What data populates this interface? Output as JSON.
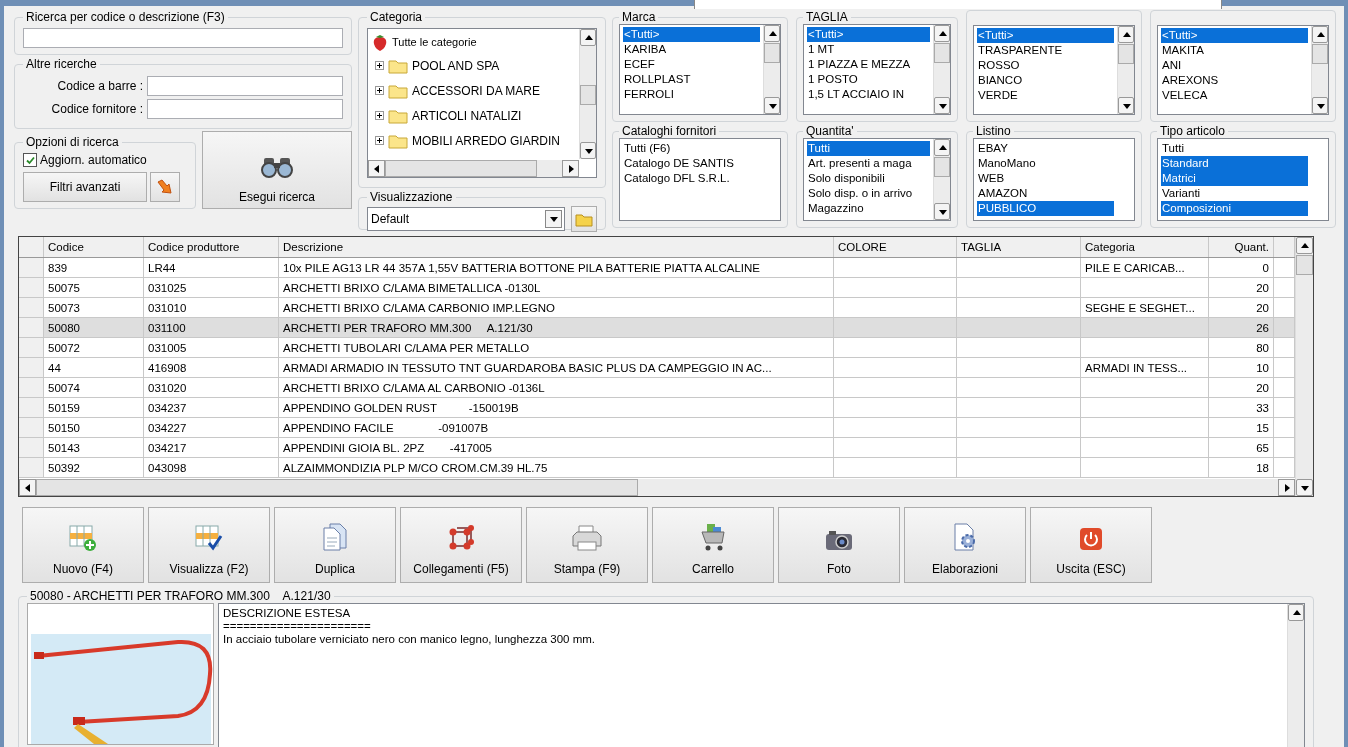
{
  "search": {
    "label": "Ricerca per codice o descrizione (F3)"
  },
  "other_searches": {
    "label": "Altre ricerche",
    "fields": [
      {
        "label": "Codice a barre :"
      },
      {
        "label": "Codice fornitore :"
      }
    ]
  },
  "search_options": {
    "label": "Opzioni di ricerca",
    "auto_update": {
      "label": "Aggiorn. automatico",
      "checked": true
    },
    "advanced_filters": "Filtri avanzati"
  },
  "run_search": "Esegui ricerca",
  "category": {
    "label": "Categoria",
    "root": "Tutte le categorie",
    "items": [
      {
        "label": "POOL AND SPA",
        "expanded": false
      },
      {
        "label": "ACCESSORI DA MARE",
        "expanded": false
      },
      {
        "label": "ARTICOLI NATALIZI",
        "expanded": false
      },
      {
        "label": "MOBILI ARREDO GIARDIN",
        "expanded": false
      }
    ]
  },
  "view": {
    "label": "Visualizzazione",
    "value": "Default"
  },
  "filters": [
    {
      "label": "Marca",
      "scroll": true,
      "items": [
        {
          "label": "<Tutti>",
          "selected": true
        },
        {
          "label": "KARIBA",
          "selected": false
        },
        {
          "label": "ECEF",
          "selected": false
        },
        {
          "label": "ROLLPLAST",
          "selected": false
        },
        {
          "label": "FERROLI",
          "selected": false
        }
      ]
    },
    {
      "label": "TAGLIA",
      "scroll": true,
      "items": [
        {
          "label": "<Tutti>",
          "selected": true
        },
        {
          "label": "1 MT",
          "selected": false
        },
        {
          "label": "1 PIAZZA E MEZZA",
          "selected": false
        },
        {
          "label": "1 POSTO",
          "selected": false
        },
        {
          "label": "1,5 LT ACCIAIO IN",
          "selected": false
        }
      ]
    },
    {
      "scroll": true,
      "items": [
        {
          "label": "<Tutti>",
          "selected": true
        },
        {
          "label": "TRASPARENTE",
          "selected": false
        },
        {
          "label": "ROSSO",
          "selected": false
        },
        {
          "label": "BIANCO",
          "selected": false
        },
        {
          "label": "VERDE",
          "selected": false
        }
      ]
    },
    {
      "scroll": true,
      "items": [
        {
          "label": "<Tutti>",
          "selected": true
        },
        {
          "label": "MAKITA",
          "selected": false
        },
        {
          "label": "ANI",
          "selected": false
        },
        {
          "label": "AREXONS",
          "selected": false
        },
        {
          "label": "VELECA",
          "selected": false
        }
      ]
    },
    {
      "label": "Cataloghi fornitori",
      "scroll": false,
      "items": [
        {
          "label": "Tutti (F6)",
          "selected": false
        },
        {
          "label": "Catalogo DE SANTIS",
          "selected": false
        },
        {
          "label": "Catalogo DFL S.R.L.",
          "selected": false
        }
      ]
    },
    {
      "label": "Quantita'",
      "scroll": true,
      "items": [
        {
          "label": "Tutti",
          "selected": true
        },
        {
          "label": "Art. presenti a maga",
          "selected": false
        },
        {
          "label": "Solo disponibili",
          "selected": false
        },
        {
          "label": "Solo disp. o in arrivo",
          "selected": false
        },
        {
          "label": "Magazzino",
          "selected": false
        }
      ]
    },
    {
      "label": "Listino",
      "scroll": false,
      "items": [
        {
          "label": "EBAY",
          "selected": false
        },
        {
          "label": "ManoMano",
          "selected": false
        },
        {
          "label": "WEB",
          "selected": false
        },
        {
          "label": "AMAZON",
          "selected": false
        },
        {
          "label": "PUBBLICO",
          "selected": true
        }
      ]
    },
    {
      "label": "Tipo articolo",
      "scroll": false,
      "items": [
        {
          "label": "Tutti",
          "selected": false
        },
        {
          "label": "Standard",
          "selected": true
        },
        {
          "label": "Matrici",
          "selected": true
        },
        {
          "label": "Varianti",
          "selected": false
        },
        {
          "label": "Composizioni",
          "selected": true
        }
      ]
    }
  ],
  "table": {
    "columns": [
      "Codice",
      "Codice produttore",
      "Descrizione",
      "COLORE",
      "TAGLIA",
      "Categoria",
      "Quant."
    ],
    "rows": [
      {
        "selected": false,
        "cells": [
          "839",
          "LR44",
          "10x PILE AG13 LR 44 357A 1,55V BATTERIA BOTTONE PILA BATTERIE PIATTA ALCALINE",
          "",
          "",
          "PILE E CARICAB...",
          "0"
        ]
      },
      {
        "selected": false,
        "cells": [
          "50075",
          "031025",
          "ARCHETTI BRIXO C/LAMA BIMETALLICA -0130L",
          "",
          "",
          "",
          "20"
        ]
      },
      {
        "selected": false,
        "cells": [
          "50073",
          "031010",
          "ARCHETTI BRIXO C/LAMA CARBONIO IMP.LEGNO",
          "",
          "",
          "SEGHE E SEGHET...",
          "20"
        ]
      },
      {
        "selected": true,
        "cells": [
          "50080",
          "031100",
          "ARCHETTI PER TRAFORO MM.300     A.121/30",
          "",
          "",
          "",
          "26"
        ]
      },
      {
        "selected": false,
        "cells": [
          "50072",
          "031005",
          "ARCHETTI TUBOLARI C/LAMA PER METALLO",
          "",
          "",
          "",
          "80"
        ]
      },
      {
        "selected": false,
        "cells": [
          "44",
          "416908",
          "ARMADI ARMADIO IN TESSUTO TNT GUARDAROBA BASIC PLUS DA CAMPEGGIO IN AC...",
          "",
          "",
          "ARMADI IN TESS...",
          "10"
        ]
      },
      {
        "selected": false,
        "cells": [
          "50074",
          "031020",
          "ARCHETTI BRIXO C/LAMA AL CARBONIO -0136L",
          "",
          "",
          "",
          "20"
        ]
      },
      {
        "selected": false,
        "cells": [
          "50159",
          "034237",
          "APPENDINO GOLDEN RUST          -150019B",
          "",
          "",
          "",
          "33"
        ]
      },
      {
        "selected": false,
        "cells": [
          "50150",
          "034227",
          "APPENDINO FACILE              -091007B",
          "",
          "",
          "",
          "15"
        ]
      },
      {
        "selected": false,
        "cells": [
          "50143",
          "034217",
          "APPENDINI GIOIA BL. 2PZ        -417005",
          "",
          "",
          "",
          "65"
        ]
      },
      {
        "selected": false,
        "cells": [
          "50392",
          "043098",
          "ALZAIMMONDIZIA PLP M/CO CROM.CM.39 HL.75",
          "",
          "",
          "",
          "18"
        ]
      }
    ]
  },
  "toolbar": [
    {
      "label": "Nuovo (F4)",
      "kind": "new"
    },
    {
      "label": "Visualizza (F2)",
      "kind": "view"
    },
    {
      "label": "Duplica",
      "kind": "copy"
    },
    {
      "label": "Collegamenti (F5)",
      "kind": "links"
    },
    {
      "label": "Stampa (F9)",
      "kind": "print"
    },
    {
      "label": "Carrello",
      "kind": "cart"
    },
    {
      "label": "Foto",
      "kind": "camera"
    },
    {
      "label": "Elaborazioni",
      "kind": "process"
    },
    {
      "label": "Uscita (ESC)",
      "kind": "exit"
    }
  ],
  "detail": {
    "title": "50080 - ARCHETTI PER TRAFORO MM.300    A.121/30",
    "picture": {
      "kind": "picture"
    },
    "lines": [
      "DESCRIZIONE ESTESA",
      "======================",
      "In acciaio tubolare verniciato nero con manico legno, lunghezza 300 mm."
    ]
  }
}
